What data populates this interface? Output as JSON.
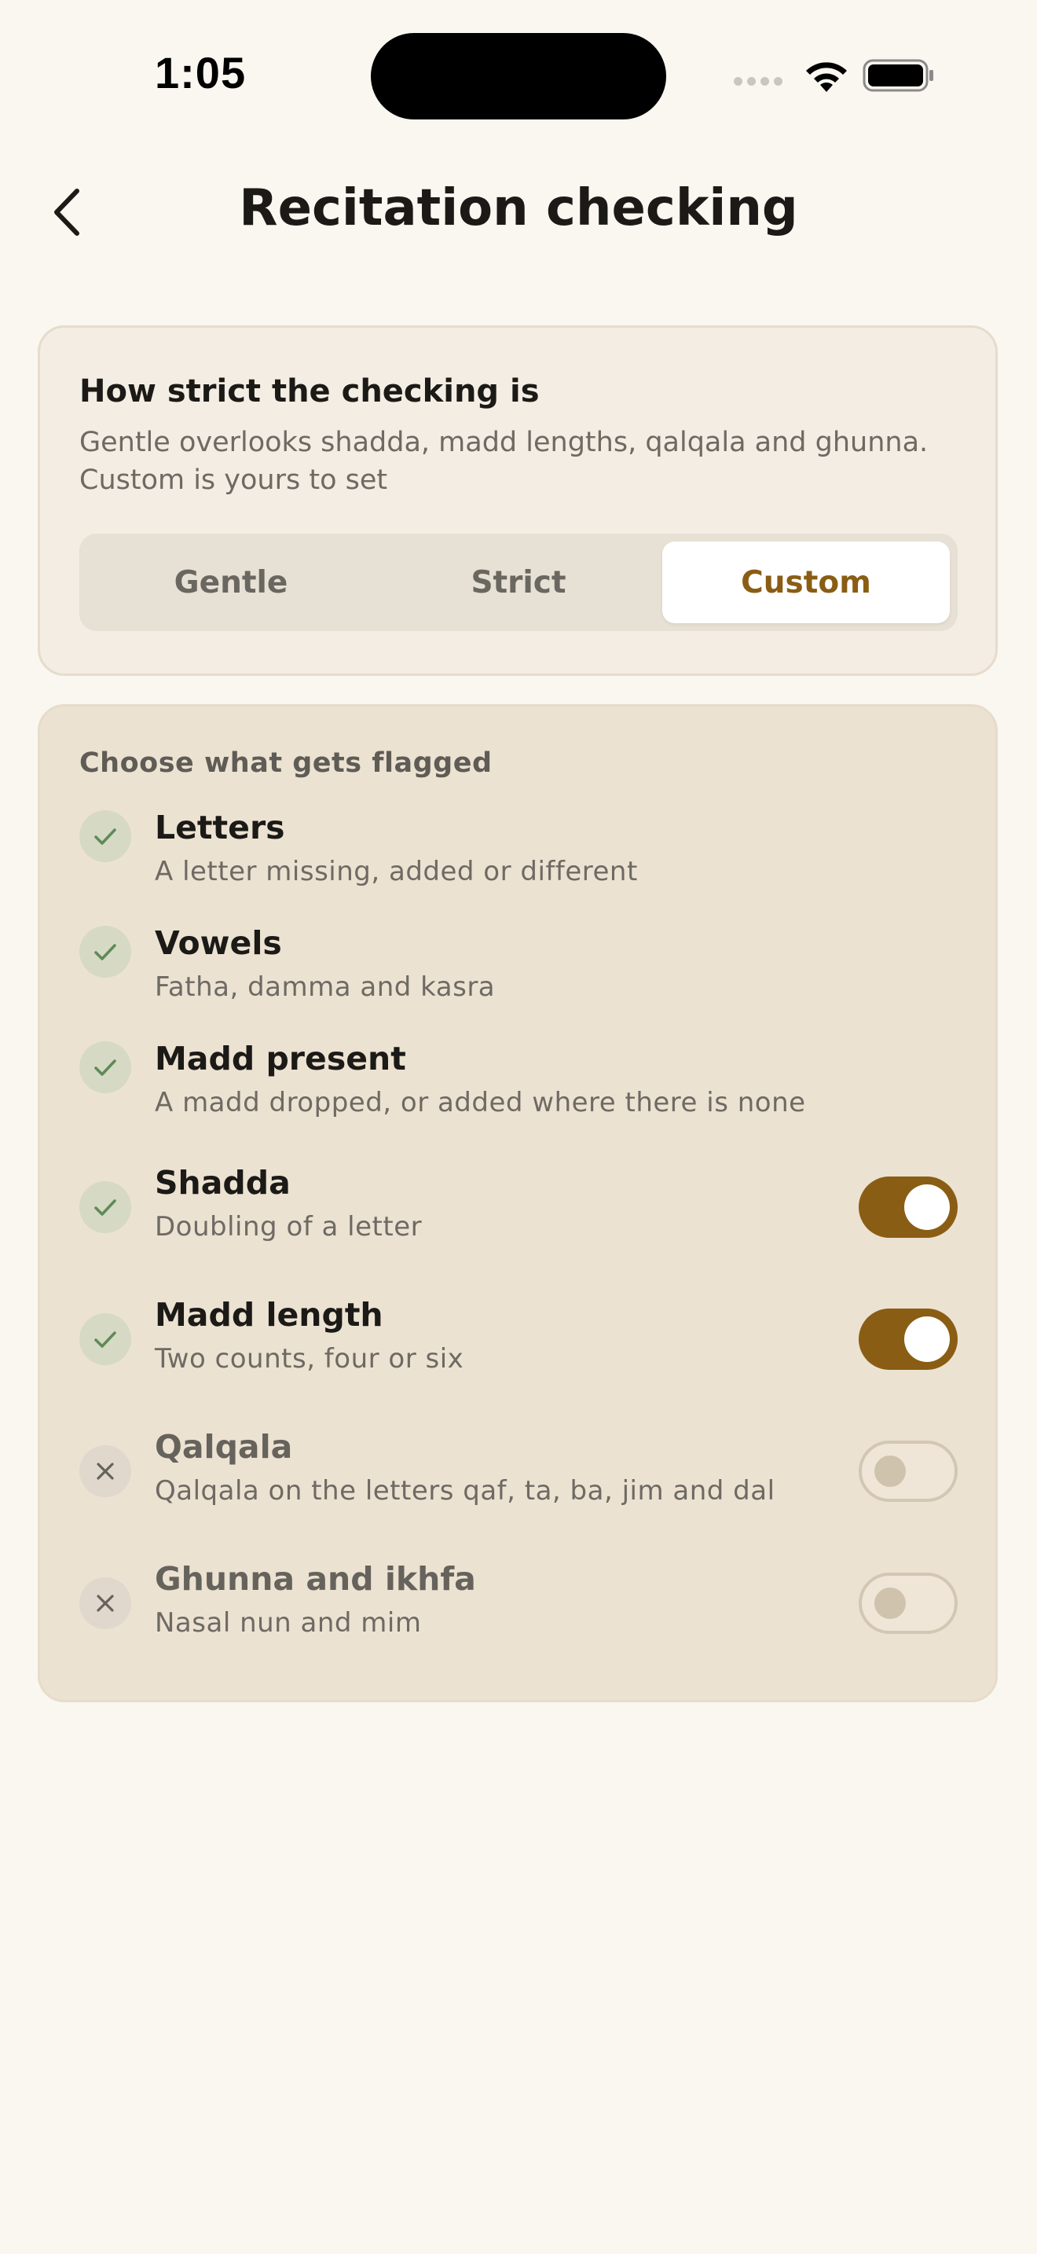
{
  "status_bar": {
    "time": "1:05"
  },
  "header": {
    "title": "Recitation checking"
  },
  "strictness": {
    "heading": "How strict the checking is",
    "description_line1": "Gentle overlooks shadda, madd lengths, qalqala and ghunna.",
    "description_line2": "Custom is yours to set",
    "options": [
      {
        "label": "Gentle",
        "selected": false
      },
      {
        "label": "Strict",
        "selected": false
      },
      {
        "label": "Custom",
        "selected": true
      }
    ]
  },
  "flags": {
    "heading": "Choose what gets flagged",
    "items": [
      {
        "title": "Letters",
        "subtitle": "A letter missing, added or different",
        "checked": true
      },
      {
        "title": "Vowels",
        "subtitle": "Fatha, damma and kasra",
        "checked": true
      },
      {
        "title": "Madd present",
        "subtitle": "A madd dropped, or added where there is none",
        "checked": true
      },
      {
        "title": "Shadda",
        "subtitle": "Doubling of a letter",
        "checked": true,
        "toggle": "on"
      },
      {
        "title": "Madd length",
        "subtitle": "Two counts, four or six",
        "checked": true,
        "toggle": "on"
      },
      {
        "title": "Qalqala",
        "subtitle": "Qalqala on the letters qaf, ta, ba, jim and dal",
        "checked": false,
        "toggle": "off"
      },
      {
        "title": "Ghunna and ikhfa",
        "subtitle": "Nasal nun and mim",
        "checked": false,
        "toggle": "off"
      }
    ]
  },
  "colors": {
    "accent": "#8a5d14",
    "background": "#faf6f0",
    "check_green": "#5e8a58"
  },
  "icons": {
    "back": "chevron-left-icon",
    "checked": "check-icon",
    "unchecked": "close-icon"
  }
}
